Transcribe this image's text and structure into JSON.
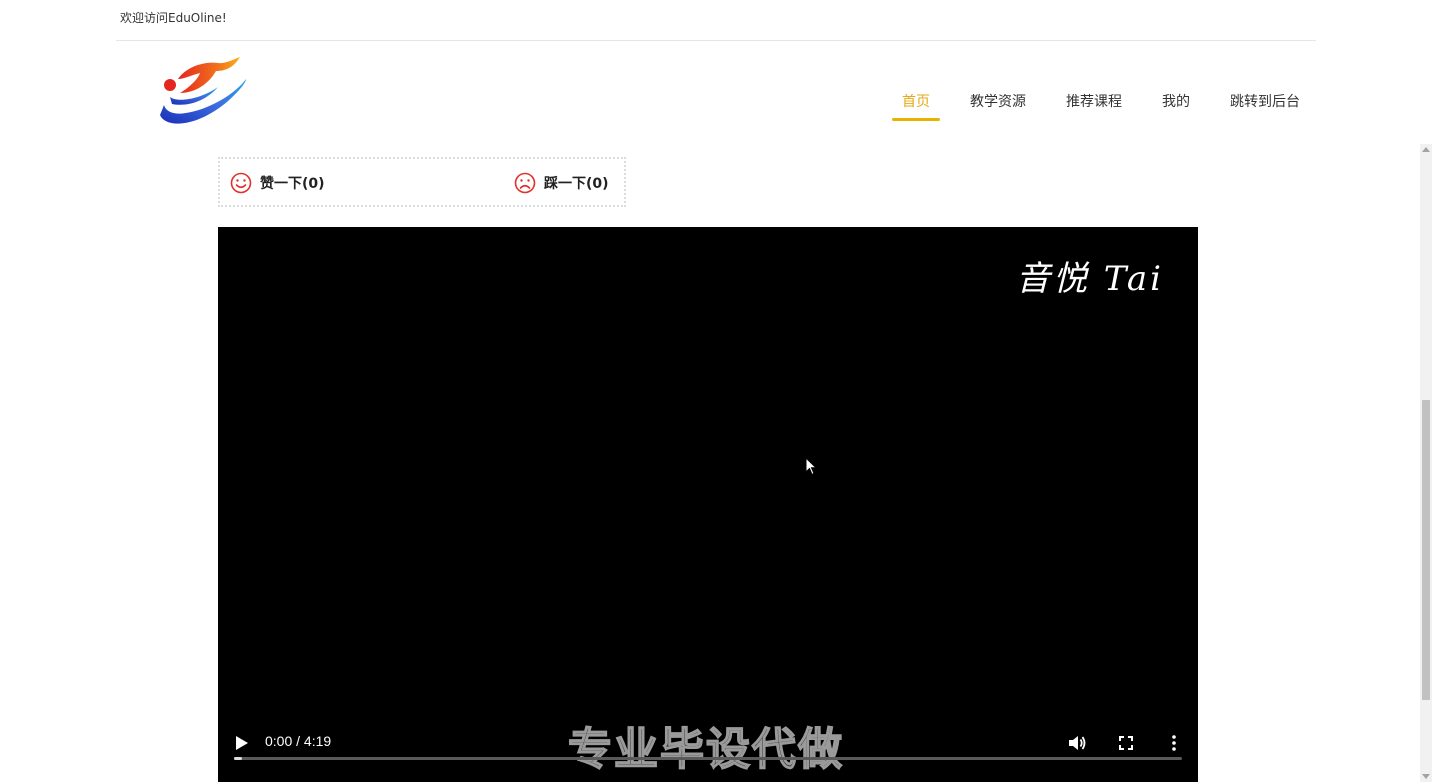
{
  "topbar": {
    "welcome": "欢迎访问EduOline!"
  },
  "nav": {
    "items": [
      {
        "label": "首页",
        "active": true
      },
      {
        "label": "教学资源",
        "active": false
      },
      {
        "label": "推荐课程",
        "active": false
      },
      {
        "label": "我的",
        "active": false
      },
      {
        "label": "跳转到后台",
        "active": false
      }
    ]
  },
  "votes": {
    "like_label": "赞一下(0)",
    "dislike_label": "踩一下(0)",
    "icon_color": "#e0302b"
  },
  "video": {
    "time": "0:00 / 4:19",
    "progress": 0.008,
    "watermark_top": "音悦 Tai",
    "watermark_bottom": "专业毕设代做"
  },
  "colors": {
    "accent": "#e6b400",
    "active_text": "#e6a817"
  }
}
